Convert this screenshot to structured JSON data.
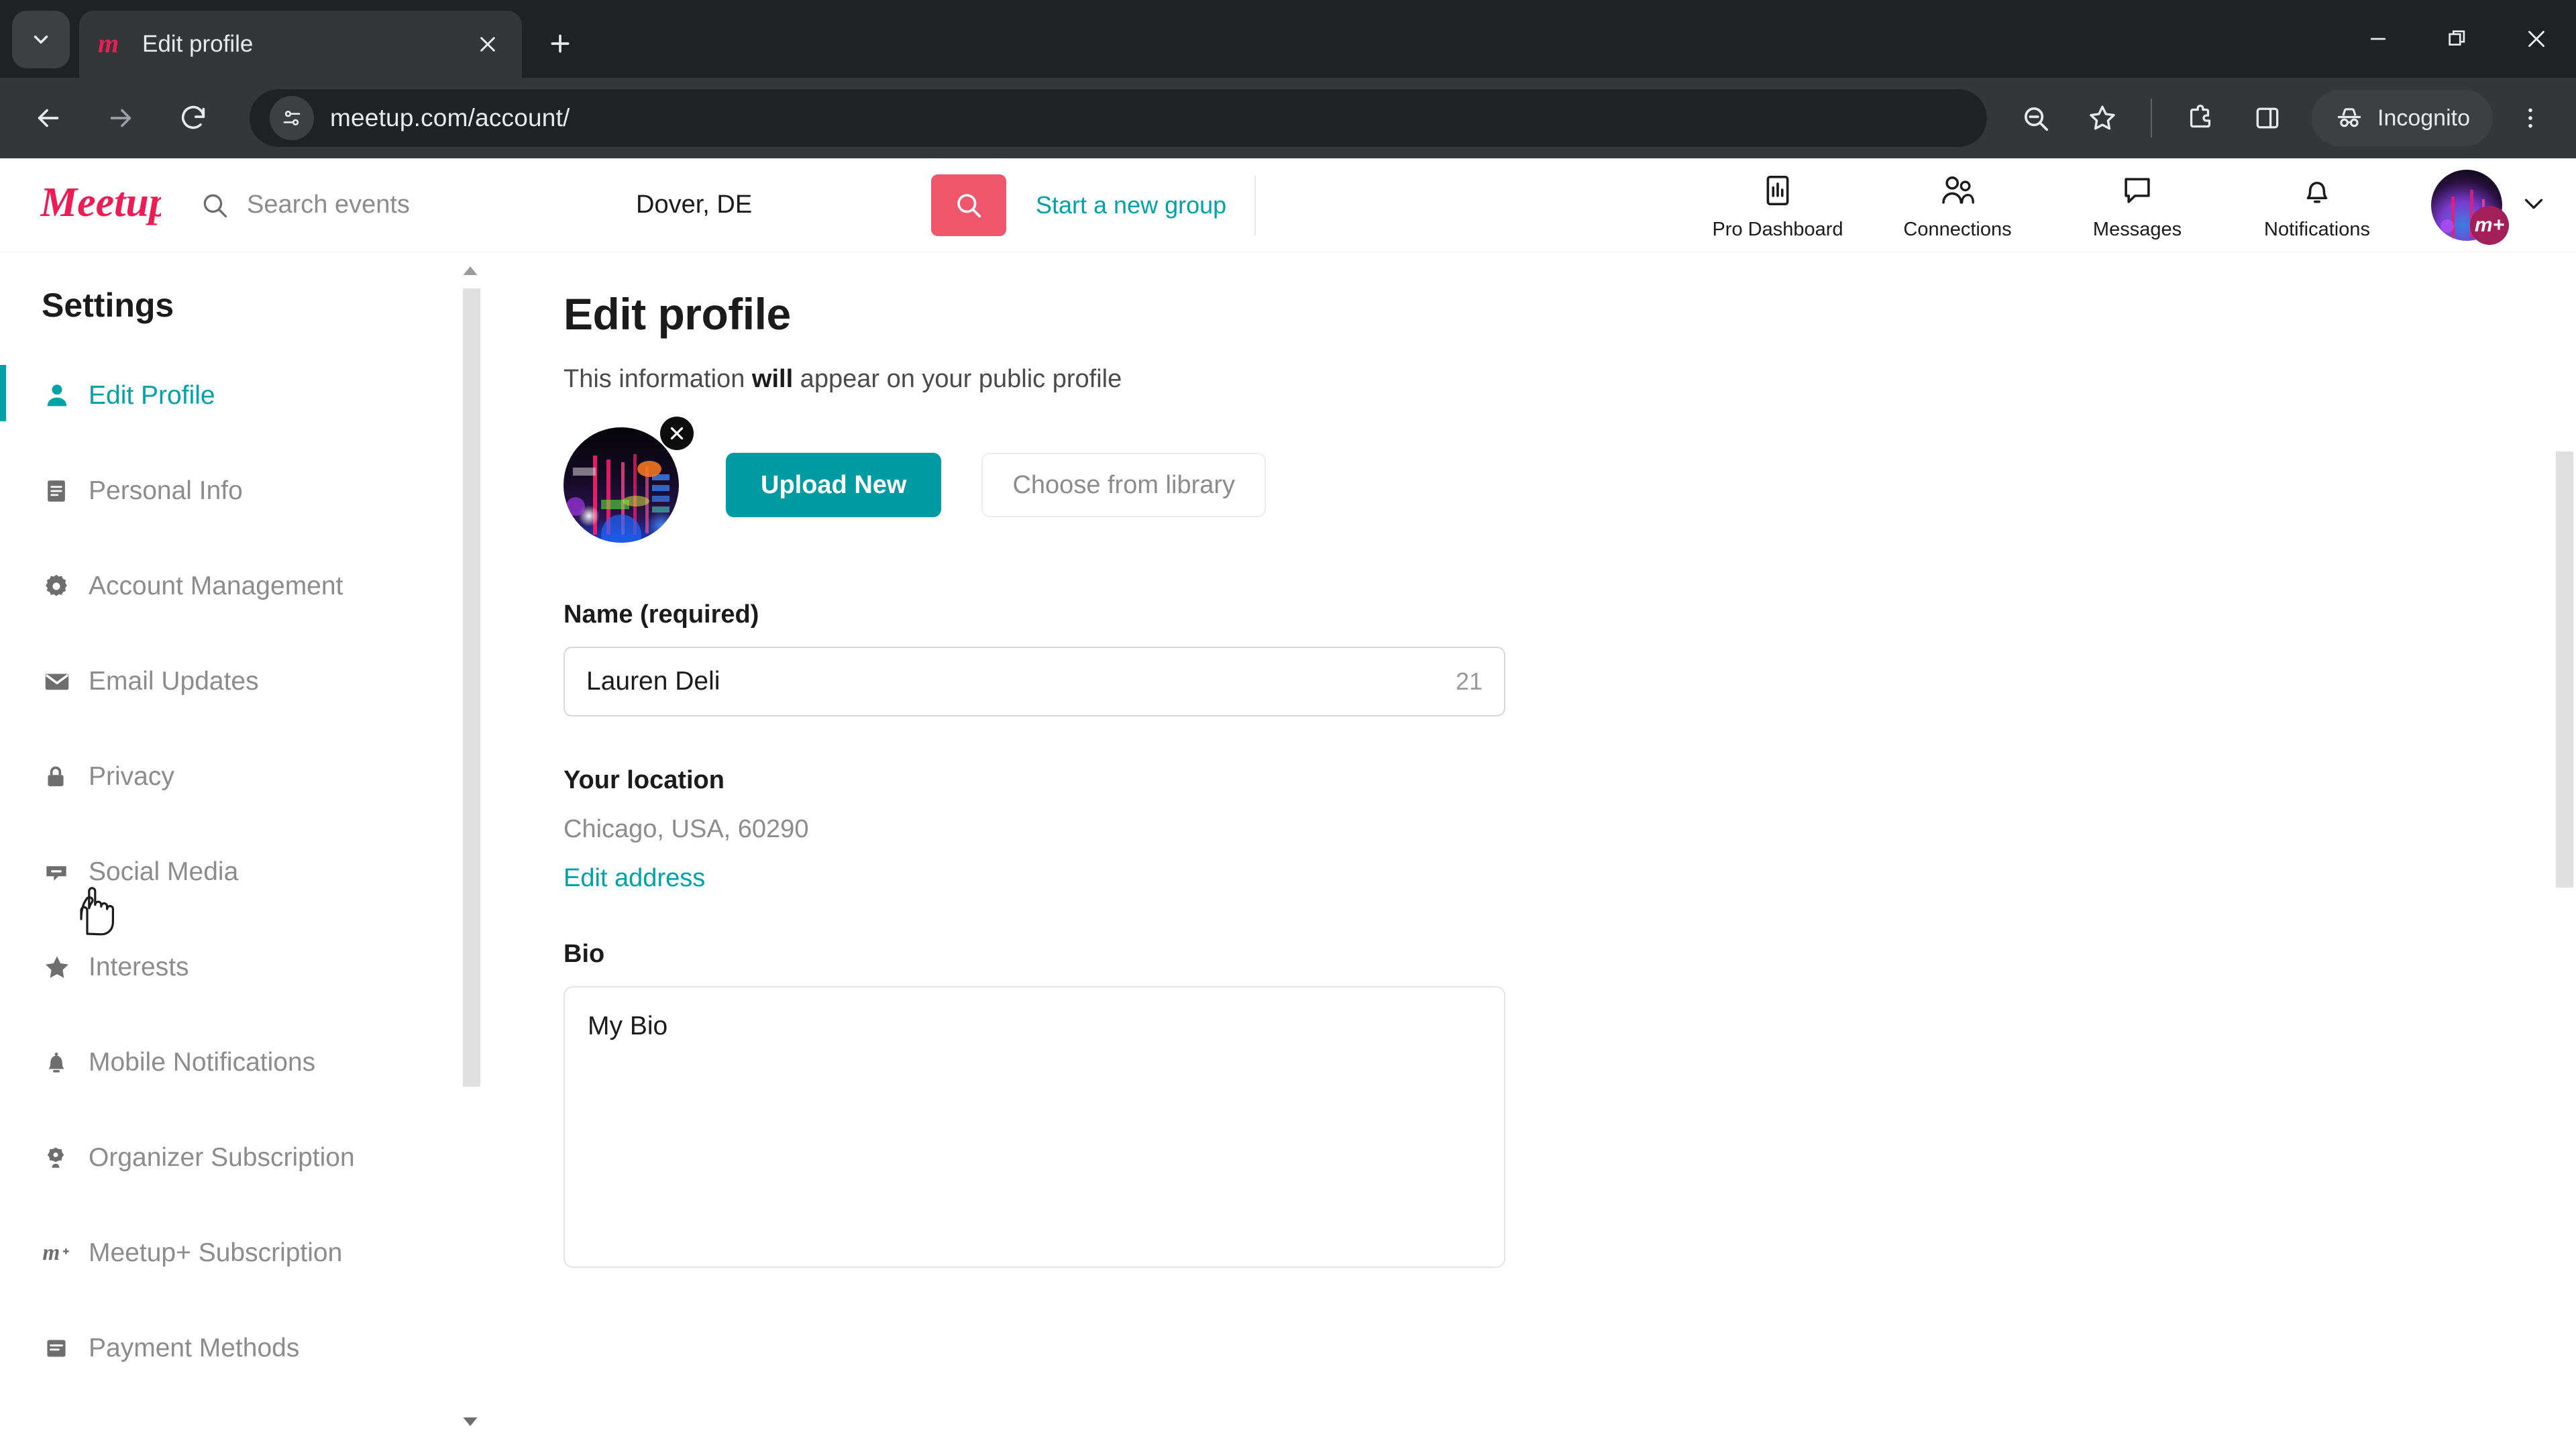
{
  "browser": {
    "tab": {
      "title": "Edit profile",
      "favicon": "meetup-m-icon"
    },
    "tab_list_icon": "chevron-down-icon",
    "new_tab_icon": "plus-icon",
    "window": {
      "minimize": "minimize-icon",
      "restore": "restore-icon",
      "close": "close-icon"
    },
    "nav": {
      "back": "back-arrow-icon",
      "forward": "forward-arrow-icon",
      "reload": "reload-icon"
    },
    "omnibox": {
      "url": "meetup.com/account/",
      "site_info_icon": "site-settings-icon"
    },
    "toolbar_icons": [
      "zoom-out-icon",
      "bookmark-star-icon",
      "extensions-icon",
      "side-panel-icon"
    ],
    "incognito": {
      "label": "Incognito",
      "icon": "incognito-icon"
    },
    "menu_icon": "kebab-menu-icon"
  },
  "site_header": {
    "logo": "meetup-logo",
    "search": {
      "placeholder": "Search events",
      "icon": "search-icon"
    },
    "location": "Dover, DE",
    "search_button_icon": "search-icon",
    "start_group_link": "Start a new group",
    "nav": [
      {
        "label": "Pro Dashboard",
        "icon": "chart-dashboard-icon"
      },
      {
        "label": "Connections",
        "icon": "people-icon"
      },
      {
        "label": "Messages",
        "icon": "speech-bubble-icon"
      },
      {
        "label": "Notifications",
        "icon": "bell-icon"
      }
    ],
    "avatar_badge": "m+",
    "avatar_caret_icon": "chevron-down-icon"
  },
  "sidebar": {
    "title": "Settings",
    "items": [
      {
        "label": "Edit Profile",
        "icon": "person-icon",
        "active": true
      },
      {
        "label": "Personal Info",
        "icon": "document-icon",
        "active": false
      },
      {
        "label": "Account Management",
        "icon": "gear-icon",
        "active": false
      },
      {
        "label": "Email Updates",
        "icon": "envelope-icon",
        "active": false
      },
      {
        "label": "Privacy",
        "icon": "lock-icon",
        "active": false
      },
      {
        "label": "Social Media",
        "icon": "social-share-icon",
        "active": false
      },
      {
        "label": "Interests",
        "icon": "star-icon",
        "active": false
      },
      {
        "label": "Mobile Notifications",
        "icon": "bell-icon",
        "active": false
      },
      {
        "label": "Organizer Subscription",
        "icon": "badge-person-icon",
        "active": false
      },
      {
        "label": "Meetup+ Subscription",
        "icon": "meetup-plus-icon",
        "active": false
      },
      {
        "label": "Payment Methods",
        "icon": "credit-card-icon",
        "active": false
      }
    ],
    "scroll_up_icon": "scroll-up-arrow-icon",
    "scroll_down_icon": "scroll-down-arrow-icon"
  },
  "main": {
    "heading": "Edit profile",
    "subtitle_pre": "This information ",
    "subtitle_bold": "will",
    "subtitle_post": " appear on your public profile",
    "photo": {
      "remove_icon": "close-circle-icon"
    },
    "upload_button": "Upload New",
    "library_button": "Choose from library",
    "name": {
      "label": "Name (required)",
      "value": "Lauren Deli",
      "counter": "21"
    },
    "location": {
      "label": "Your location",
      "value": "Chicago, USA, 60290",
      "edit_link": "Edit address"
    },
    "bio": {
      "label": "Bio",
      "value": "My Bio"
    }
  },
  "colors": {
    "teal": "#00a2a8",
    "teal_button": "#009ba2",
    "meetup_pink": "#f0566b",
    "logo_pink": "#ed1c55",
    "chrome_dark": "#202124",
    "chrome_toolbar": "#35363a"
  }
}
